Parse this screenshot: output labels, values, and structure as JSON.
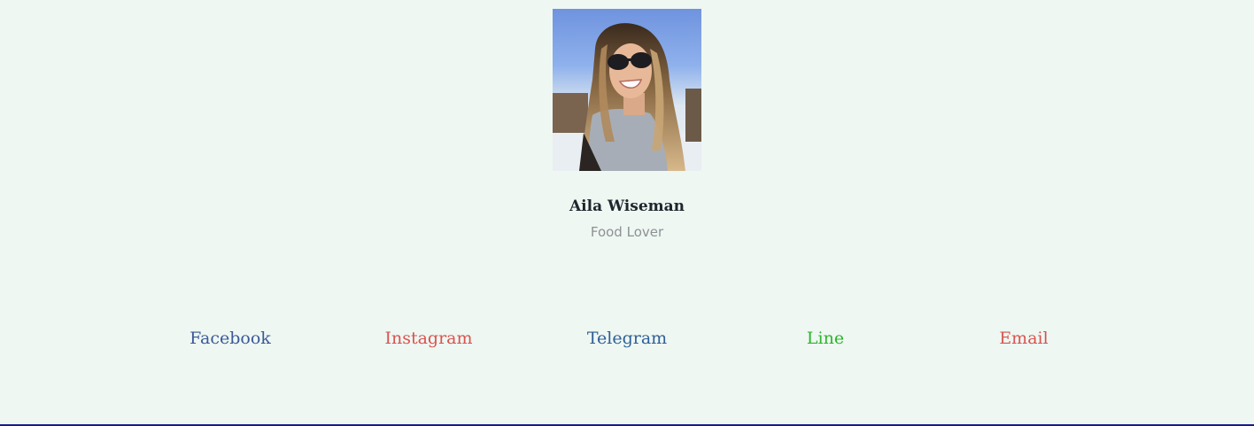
{
  "profile": {
    "name": "Aila Wiseman",
    "role": "Food Lover"
  },
  "social": {
    "facebook": "Facebook",
    "instagram": "Instagram",
    "telegram": "Telegram",
    "line": "Line",
    "email": "Email"
  },
  "colors": {
    "background": "#eef7f2",
    "facebook": "#3b5998",
    "instagram": "#d9534f",
    "telegram": "#2e5f96",
    "line": "#2bb52b",
    "email": "#d9534f"
  }
}
